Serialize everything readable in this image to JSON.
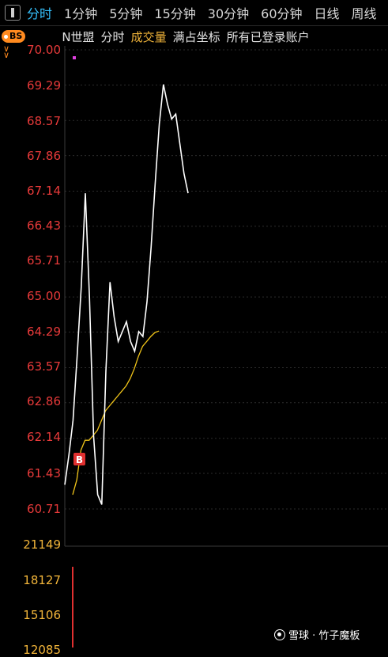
{
  "tabs": [
    {
      "label": "分时",
      "active": true
    },
    {
      "label": "1分钟",
      "active": false
    },
    {
      "label": "5分钟",
      "active": false
    },
    {
      "label": "15分钟",
      "active": false
    },
    {
      "label": "30分钟",
      "active": false
    },
    {
      "label": "60分钟",
      "active": false
    },
    {
      "label": "日线",
      "active": false
    },
    {
      "label": "周线",
      "active": false
    }
  ],
  "info": {
    "bs_badge": "BS",
    "stock_name": "N世盟",
    "mode": "分时",
    "indicator": "成交量",
    "coord_mode": "满占坐标",
    "account": "所有已登录账户"
  },
  "price_axis": [
    "70.00",
    "69.29",
    "68.57",
    "67.86",
    "67.14",
    "66.43",
    "65.71",
    "65.00",
    "64.29",
    "63.57",
    "62.86",
    "62.14",
    "61.43",
    "60.71"
  ],
  "volume_axis": [
    "21149",
    "18127",
    "15106",
    "12085"
  ],
  "marker": {
    "label": "B"
  },
  "watermark": "雪球 · 竹子魔板",
  "colors": {
    "background": "#000000",
    "price_line": "#ffffff",
    "avg_line": "#f0c419",
    "axis_red": "#e83a3a",
    "volume_label": "#f2b53a",
    "active_tab": "#36c3ff",
    "badge": "#ff8a1f",
    "marker": "#e03030"
  },
  "chart_data": {
    "type": "line",
    "ylim": [
      60.71,
      70.0
    ],
    "series": [
      {
        "values": [
          61.2,
          61.8,
          62.5,
          63.8,
          65.2,
          67.1,
          65.0,
          62.2,
          61.0,
          60.8,
          63.5,
          65.3,
          64.6,
          64.1,
          64.3,
          64.5,
          64.1,
          63.9,
          64.3,
          64.2,
          64.9,
          66.0,
          67.3,
          68.5,
          69.3,
          68.9,
          68.6,
          68.7,
          68.1,
          67.5,
          67.1
        ]
      },
      {
        "values": [
          61.0,
          61.3,
          61.9,
          62.1,
          62.1,
          62.2,
          62.3,
          62.5,
          62.7,
          62.8,
          62.9,
          63.0,
          63.1,
          63.2,
          63.35,
          63.55,
          63.8,
          64.0,
          64.1,
          64.2,
          64.28,
          64.31
        ]
      }
    ]
  }
}
